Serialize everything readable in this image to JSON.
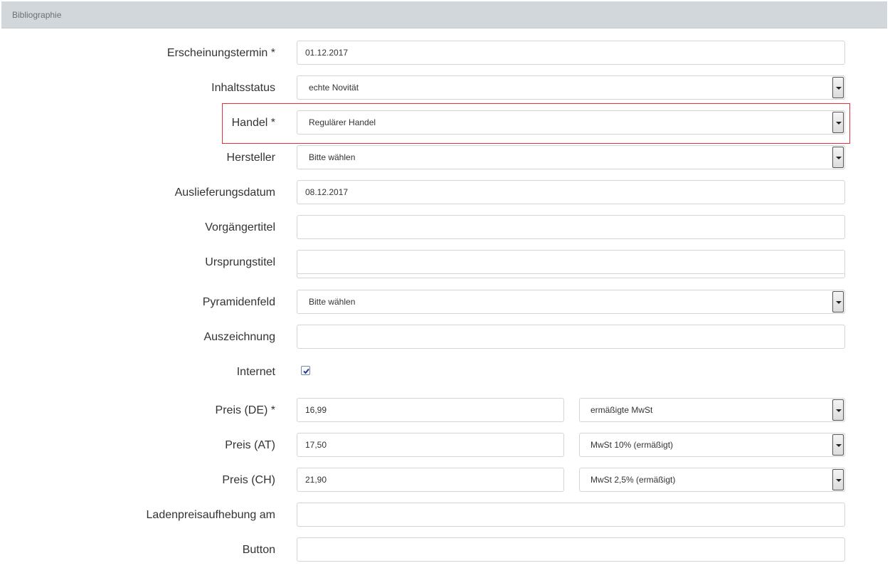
{
  "panel": {
    "title": "Bibliographie"
  },
  "fields": {
    "erscheinungstermin": {
      "label": "Erscheinungstermin *",
      "value": "01.12.2017"
    },
    "inhaltsstatus": {
      "label": "Inhaltsstatus",
      "value": "echte Novität"
    },
    "handel": {
      "label": "Handel *",
      "value": "Regulärer Handel"
    },
    "hersteller": {
      "label": "Hersteller",
      "value": "Bitte wählen"
    },
    "auslieferungsdatum": {
      "label": "Auslieferungsdatum",
      "value": "08.12.2017"
    },
    "vorgaengertitel": {
      "label": "Vorgängertitel",
      "value": ""
    },
    "ursprungstitel": {
      "label": "Ursprungstitel",
      "value": ""
    },
    "pyramidenfeld": {
      "label": "Pyramidenfeld",
      "value": "Bitte wählen"
    },
    "auszeichnung": {
      "label": "Auszeichnung",
      "value": ""
    },
    "internet": {
      "label": "Internet",
      "checked": true
    },
    "preis_de": {
      "label": "Preis (DE) *",
      "value": "16,99",
      "tax": "ermäßigte MwSt"
    },
    "preis_at": {
      "label": "Preis (AT)",
      "value": "17,50",
      "tax": "MwSt 10% (ermäßigt)"
    },
    "preis_ch": {
      "label": "Preis (CH)",
      "value": "21,90",
      "tax": "MwSt 2,5% (ermäßigt)"
    },
    "ladenpreisaufhebung": {
      "label": "Ladenpreisaufhebung am",
      "value": ""
    },
    "button": {
      "label": "Button",
      "value": ""
    }
  },
  "colors": {
    "highlight": "#e3323c",
    "header_bg": "#d2d7dc"
  },
  "icons": {
    "select_arrow": "chevron-down-icon",
    "checkbox": "checkmark-icon"
  }
}
